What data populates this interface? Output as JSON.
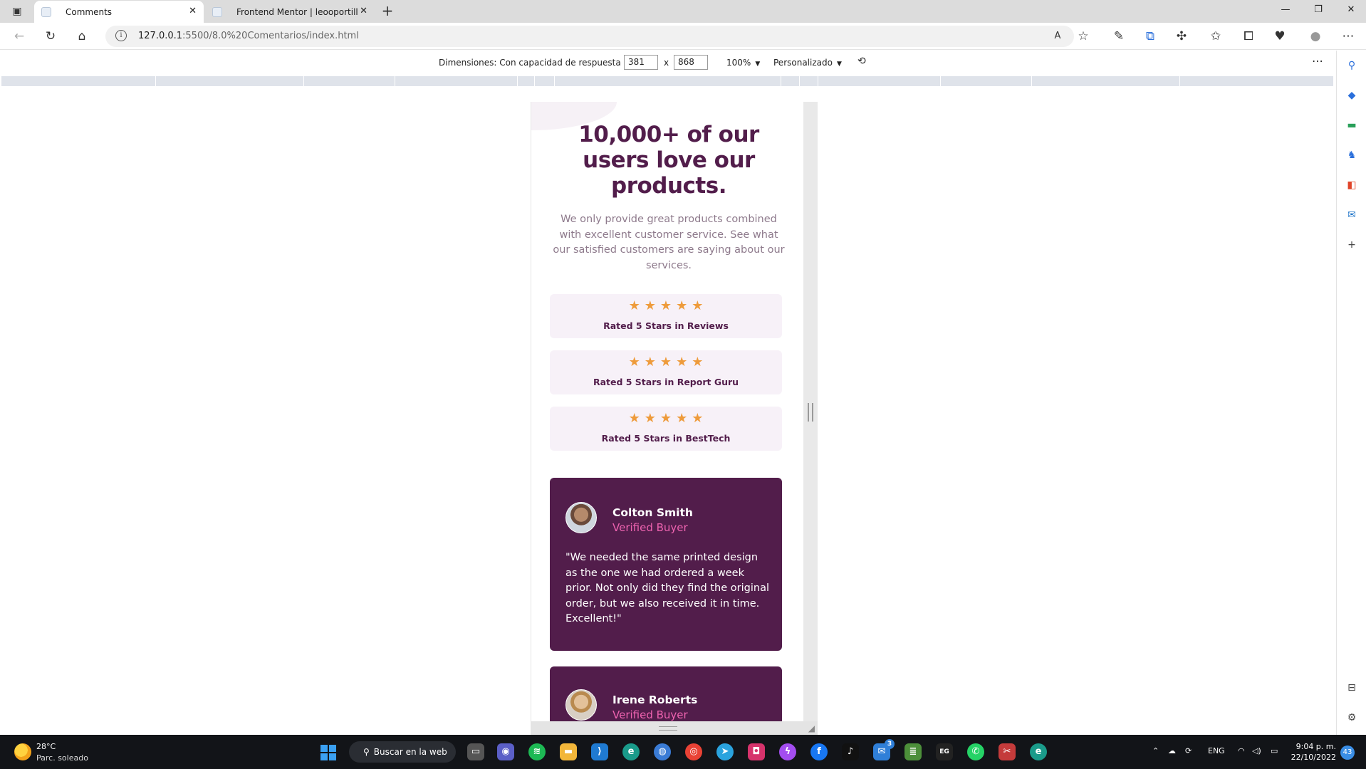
{
  "browser": {
    "tabs": [
      {
        "title": "Comments",
        "active": true
      },
      {
        "title": "Frontend Mentor | leooportilla's",
        "active": false
      }
    ],
    "address": {
      "host": "127.0.0.1",
      "path": ":5500/8.0%20Comentarios/index.html"
    }
  },
  "devtools": {
    "dimensions_label": "Dimensiones: Con capacidad de respuesta",
    "width": "381",
    "height": "868",
    "times": "x",
    "zoom": "100%",
    "throttle": "Personalizado"
  },
  "page": {
    "title": "10,000+ of our users love our products.",
    "subtitle": "We only provide great products combined with excellent customer service. See what our satisfied customers are saying about our services.",
    "stars": "★★★★★",
    "ratings": [
      {
        "label": "Rated 5 Stars in Reviews"
      },
      {
        "label": "Rated 5 Stars in Report Guru"
      },
      {
        "label": "Rated 5 Stars in BestTech"
      }
    ],
    "reviews": [
      {
        "name": "Colton Smith",
        "badge": "Verified Buyer",
        "text": "\"We needed the same printed design as the one we had ordered a week prior. Not only did they find the original order, but we also received it in time. Excellent!\""
      },
      {
        "name": "Irene Roberts",
        "badge": "Verified Buyer",
        "text": ""
      }
    ],
    "colors": {
      "dark_magenta": "#521d4b",
      "soft_pink": "#ee63b0",
      "light_pink": "#f7f1f8",
      "star_orange": "#ee9b3b"
    }
  },
  "taskbar": {
    "weather_temp": "28°C",
    "weather_desc": "Parc. soleado",
    "search_label": "Buscar en la web",
    "lang": "ENG",
    "time": "9:04 p. m.",
    "date": "22/10/2022",
    "notifications": "43",
    "mail_badge": "3"
  }
}
